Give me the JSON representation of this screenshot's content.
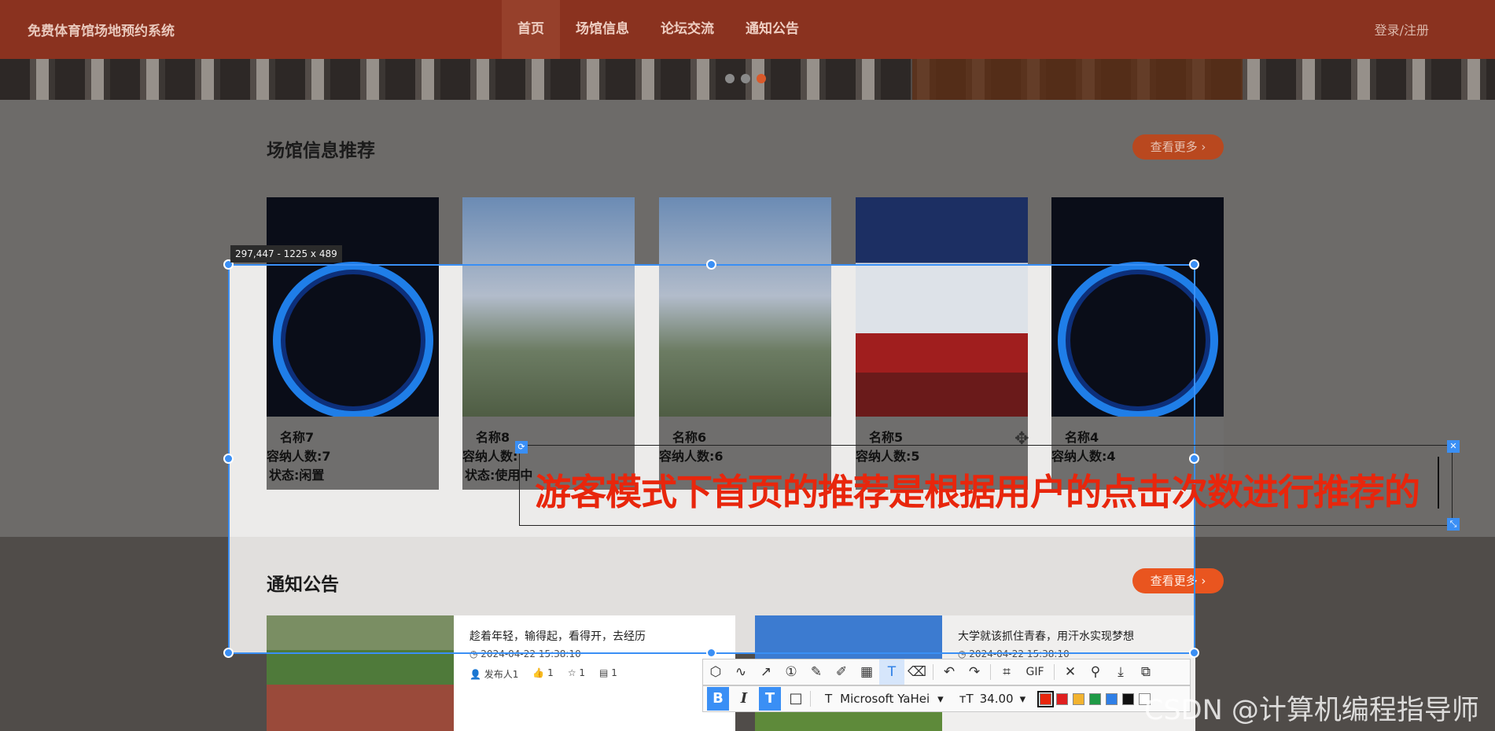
{
  "header": {
    "site_title": "免费体育馆场地预约系统",
    "nav": [
      "首页",
      "场馆信息",
      "论坛交流",
      "通知公告"
    ],
    "login": "登录/注册"
  },
  "banner": {
    "dots": 3,
    "active_dot": 3
  },
  "venues_section": {
    "title": "场馆信息推荐",
    "more": "查看更多",
    "cards": [
      {
        "name": "名称7",
        "capacity": "容纳人数:7",
        "status": "状态:闲置"
      },
      {
        "name": "名称8",
        "capacity": "容纳人数:",
        "status": "状态:使用中"
      },
      {
        "name": "名称6",
        "capacity": "容纳人数:6",
        "status": ""
      },
      {
        "name": "名称5",
        "capacity": "容纳人数:5",
        "status": ""
      },
      {
        "name": "名称4",
        "capacity": "容纳人数:4",
        "status": ""
      }
    ]
  },
  "notice_section": {
    "title": "通知公告",
    "more": "查看更多",
    "items": [
      {
        "title": "趁着年轻，输得起，看得开，去经历",
        "date": "2024-04-22 15:38:10",
        "author": "发布人1",
        "likes": "1",
        "stars": "1",
        "comments": "1"
      },
      {
        "title": "大学就该抓住青春，用汗水实现梦想",
        "date": "2024-04-22 15:38:10"
      }
    ]
  },
  "capture": {
    "size_label": "297,447 - 1225 x 489",
    "annotation": "游客模式下首页的推荐是根据用户的点击次数进行推荐的",
    "annotation_color": "#e8260c",
    "font_name": "Microsoft YaHei",
    "font_size": "34.00",
    "gif_label": "GIF",
    "tools": [
      "shape-icon",
      "curve-icon",
      "arrow-icon",
      "number-icon",
      "pen-icon",
      "marker-icon",
      "mosaic-icon",
      "text-icon",
      "eraser-icon",
      "undo-icon",
      "redo-icon",
      "record-icon",
      "gif",
      "close-icon",
      "pin-icon",
      "download-icon",
      "copy-icon"
    ],
    "swatch_colors": [
      "#e8260c",
      "#e02020",
      "#f2b32f",
      "#1f9a46",
      "#2f7fe6",
      "#111111",
      "#ffffff"
    ]
  },
  "watermark": "CSDN @计算机编程指导师"
}
